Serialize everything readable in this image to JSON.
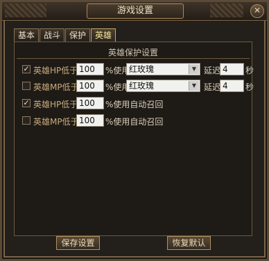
{
  "window": {
    "title": "游戏设置",
    "close_label": "✕"
  },
  "tabs": [
    {
      "label": "基本",
      "active": false
    },
    {
      "label": "战斗",
      "active": false
    },
    {
      "label": "保护",
      "active": false
    },
    {
      "label": "英雄",
      "active": true
    }
  ],
  "section": {
    "title": "英雄保护设置"
  },
  "rows": [
    {
      "checked": true,
      "prefix": "英雄HP低于",
      "value": "100",
      "pct_label": "%使用",
      "item": "红玫瑰",
      "delay_label": "延迟",
      "delay": "4",
      "unit": "秒"
    },
    {
      "checked": false,
      "prefix": "英雄MP低于",
      "value": "100",
      "pct_label": "%使用",
      "item": "红玫瑰",
      "delay_label": "延迟",
      "delay": "4",
      "unit": "秒"
    },
    {
      "checked": true,
      "prefix": "英雄HP低于",
      "value": "100",
      "action": "%使用自动召回"
    },
    {
      "checked": false,
      "prefix": "英雄MP低于",
      "value": "100",
      "action": "%使用自动召回"
    }
  ],
  "buttons": {
    "save": "保存设置",
    "reset": "恢复默认"
  },
  "check_mark": "✓"
}
